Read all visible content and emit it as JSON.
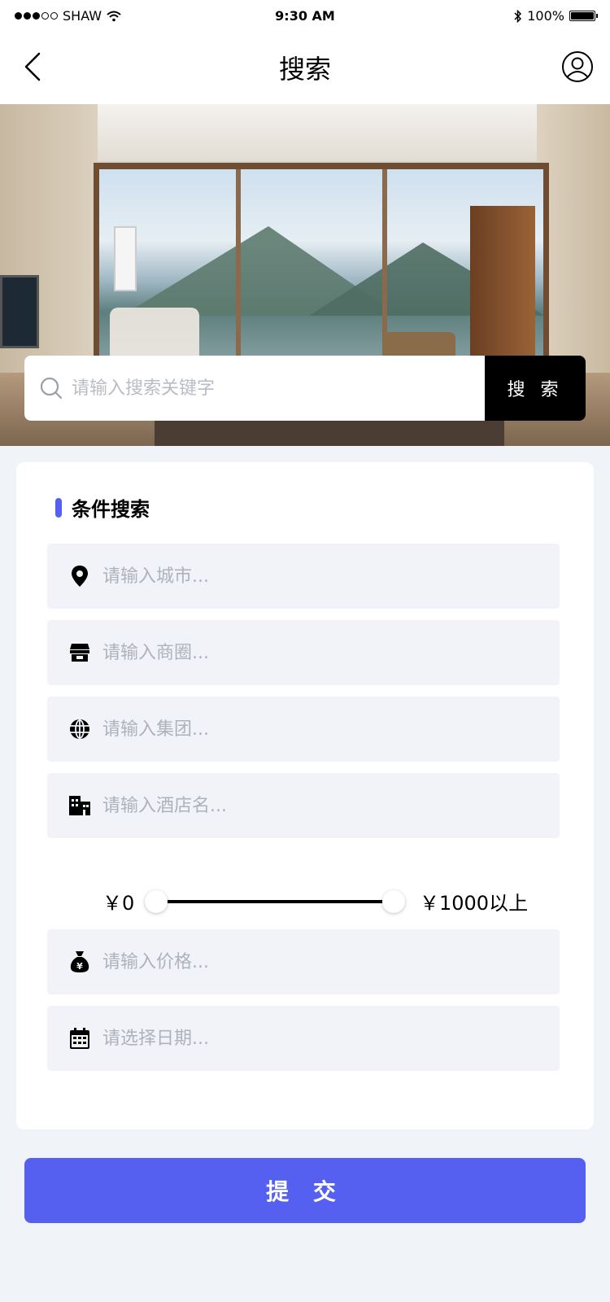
{
  "status_bar": {
    "carrier": "SHAW",
    "time": "9:30 AM",
    "battery": "100%"
  },
  "nav": {
    "title": "搜索"
  },
  "search": {
    "placeholder": "请输入搜索关键字",
    "button_label": "搜 索"
  },
  "filter": {
    "section_title": "条件搜索",
    "fields": [
      {
        "icon": "map-pin-icon",
        "placeholder": "请输入城市..."
      },
      {
        "icon": "storefront-icon",
        "placeholder": "请输入商圈..."
      },
      {
        "icon": "globe-icon",
        "placeholder": "请输入集团..."
      },
      {
        "icon": "building-icon",
        "placeholder": "请输入酒店名..."
      }
    ],
    "price_range": {
      "min_label": "￥0",
      "max_label": "￥1000以上",
      "low_fraction": 0,
      "high_fraction": 1
    },
    "price_field": {
      "icon": "money-bag-icon",
      "placeholder": "请输入价格..."
    },
    "date_field": {
      "icon": "calendar-icon",
      "placeholder": "请选择日期..."
    }
  },
  "submit": {
    "label": "提 交"
  },
  "colors": {
    "accent": "#5660f0",
    "background": "#f0f3f8",
    "field_background": "#f1f3f8",
    "search_button": "#000000"
  }
}
